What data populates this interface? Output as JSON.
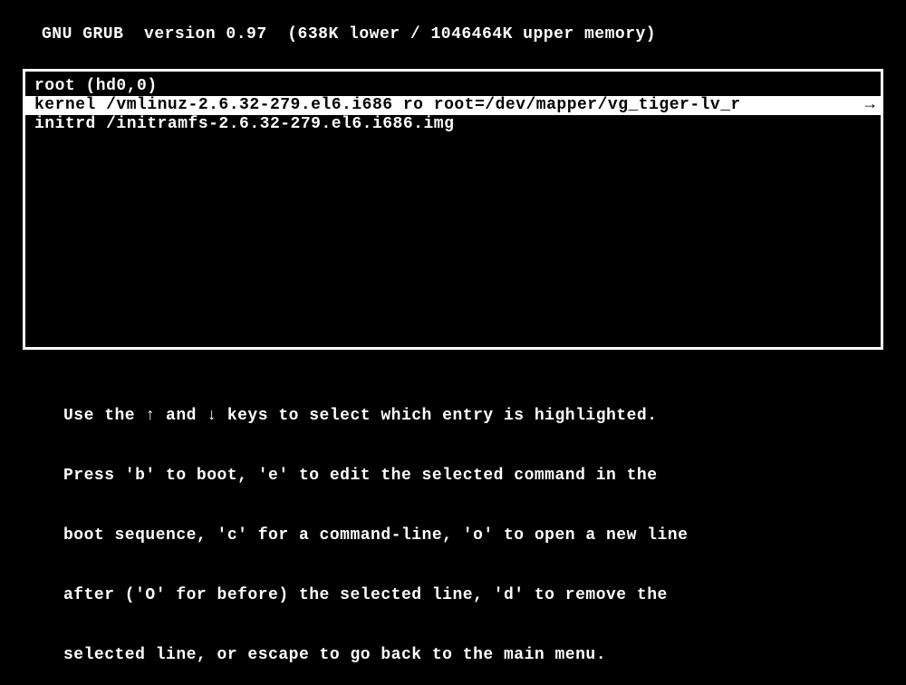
{
  "header": {
    "title": "GNU GRUB  version 0.97  (638K lower / 1046464K upper memory)"
  },
  "menu": {
    "lines": [
      {
        "text": "root (hd0,0)",
        "selected": false,
        "overflow": false
      },
      {
        "text": "kernel /vmlinuz-2.6.32-279.el6.i686 ro root=/dev/mapper/vg_tiger-lv_r",
        "selected": true,
        "overflow": true
      },
      {
        "text": "initrd /initramfs-2.6.32-279.el6.i686.img",
        "selected": false,
        "overflow": false
      }
    ],
    "overflow_glyph": "→"
  },
  "instructions": {
    "line1": "Use the ↑ and ↓ keys to select which entry is highlighted.",
    "line2": "Press 'b' to boot, 'e' to edit the selected command in the",
    "line3": "boot sequence, 'c' for a command-line, 'o' to open a new line",
    "line4": "after ('O' for before) the selected line, 'd' to remove the",
    "line5": "selected line, or escape to go back to the main menu."
  }
}
